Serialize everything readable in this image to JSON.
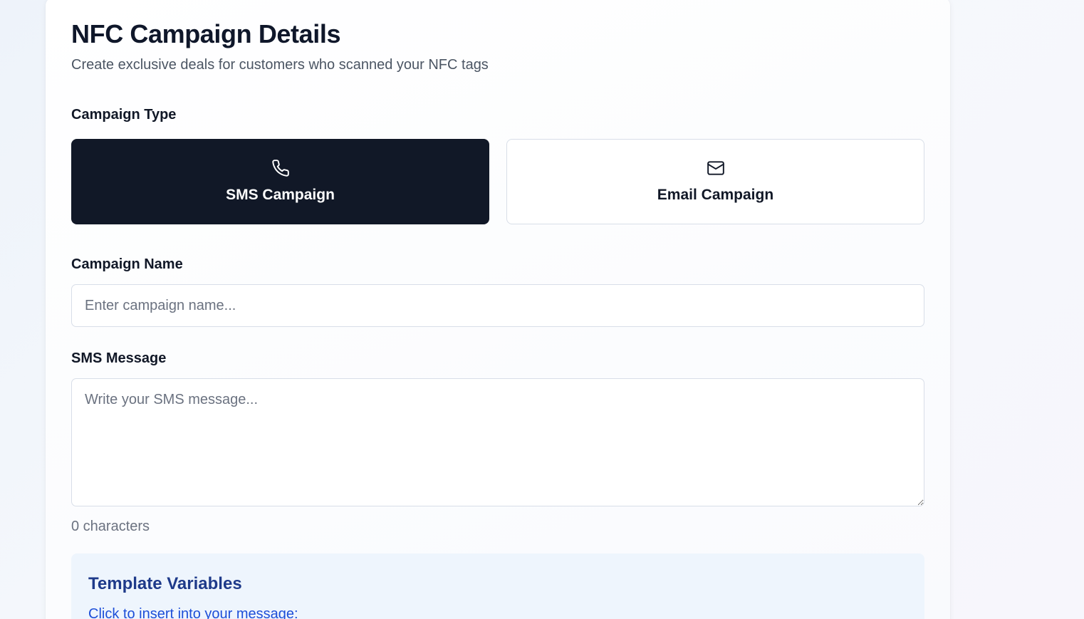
{
  "header": {
    "title": "NFC Campaign Details",
    "subtitle": "Create exclusive deals for customers who scanned your NFC tags"
  },
  "campaign_type": {
    "label": "Campaign Type",
    "options": [
      {
        "label": "SMS Campaign",
        "icon": "phone-icon",
        "selected": true
      },
      {
        "label": "Email Campaign",
        "icon": "mail-icon",
        "selected": false
      }
    ]
  },
  "campaign_name": {
    "label": "Campaign Name",
    "placeholder": "Enter campaign name...",
    "value": ""
  },
  "sms_message": {
    "label": "SMS Message",
    "placeholder": "Write your SMS message...",
    "value": "",
    "char_count_text": "0 characters"
  },
  "template_variables": {
    "title": "Template Variables",
    "hint": "Click to insert into your message:"
  },
  "colors": {
    "selected_bg": "#111827",
    "accent_blue": "#1d4ed8",
    "template_bg": "#eef5fd"
  }
}
